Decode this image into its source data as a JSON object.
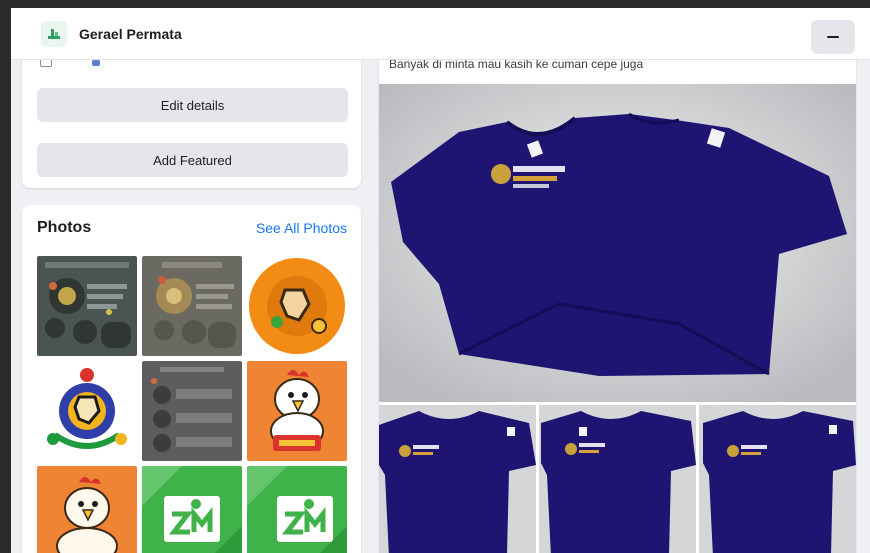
{
  "header": {
    "app_name": "Gerael Permata"
  },
  "profile_actions": {
    "edit_details_label": "Edit details",
    "add_featured_label": "Add Featured"
  },
  "photos": {
    "title": "Photos",
    "see_all_label": "See All Photos",
    "tiles": [
      "infographic-dark",
      "infographic-tan",
      "logo-orange-circle",
      "logo-gear",
      "infographic-gray",
      "mascot-rooster-orange",
      "mascot-rooster-orange-2",
      "logo-zm-green",
      "logo-zm-green-2"
    ]
  },
  "post": {
    "caption": "Banyak di minta mau kasih ke cuman cepe juga"
  },
  "colors": {
    "accent_link": "#1877f2",
    "shirt_navy": "#1f1472",
    "page_bg": "#eef0f3"
  }
}
